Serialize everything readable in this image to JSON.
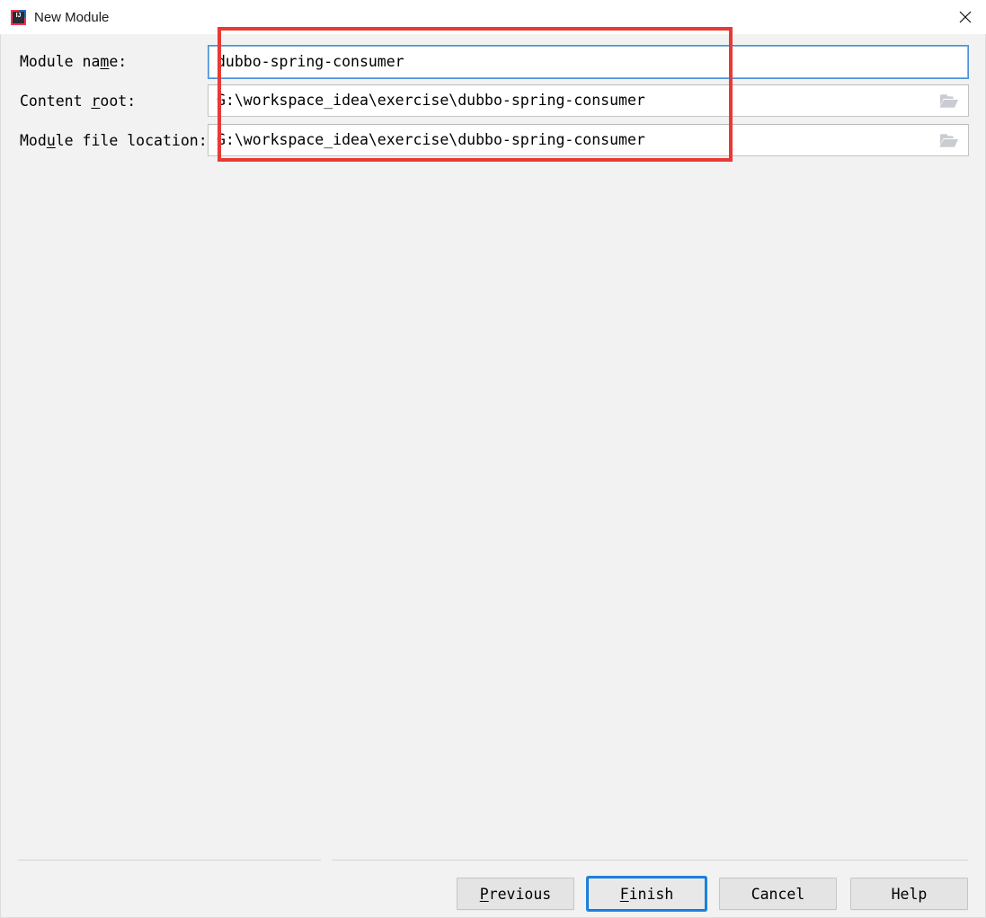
{
  "window": {
    "title": "New Module",
    "app_icon": "intellij-idea-icon",
    "close_icon": "close-icon",
    "background_color": "#f2f2f2"
  },
  "form": {
    "rows": [
      {
        "name": "module-name",
        "label_before": "Module na",
        "label_mnemonic": "m",
        "label_after": "e:",
        "value": "dubbo-spring-consumer",
        "placeholder": "",
        "focused": true,
        "has_browse": false
      },
      {
        "name": "content-root",
        "label_before": "Content ",
        "label_mnemonic": "r",
        "label_after": "oot:",
        "value": "G:\\workspace_idea\\exercise\\dubbo-spring-consumer",
        "placeholder": "",
        "focused": false,
        "has_browse": true,
        "browse_icon": "folder-icon"
      },
      {
        "name": "module-file-location",
        "label_before": "Mod",
        "label_mnemonic": "u",
        "label_after": "le file location:",
        "value": "G:\\workspace_idea\\exercise\\dubbo-spring-consumer",
        "placeholder": "",
        "focused": false,
        "has_browse": true,
        "browse_icon": "folder-icon"
      }
    ]
  },
  "footer": {
    "buttons": [
      {
        "name": "previous",
        "before": "",
        "mnemonic": "P",
        "after": "revious",
        "default": false
      },
      {
        "name": "finish",
        "before": "",
        "mnemonic": "F",
        "after": "inish",
        "default": true
      },
      {
        "name": "cancel",
        "before": "Cancel",
        "mnemonic": "",
        "after": "",
        "default": false
      },
      {
        "name": "help",
        "before": "Help",
        "mnemonic": "",
        "after": "",
        "default": false
      }
    ]
  },
  "annotation": {
    "highlight_color": "#e83a35",
    "focus_color": "#1d84e2"
  }
}
